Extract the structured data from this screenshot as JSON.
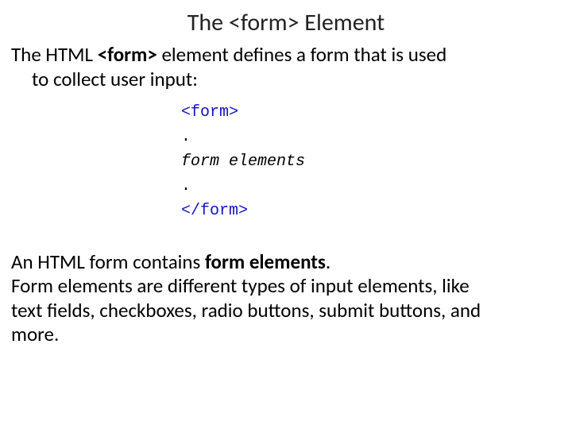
{
  "title": "The <form> Element",
  "intro": {
    "part1": "The HTML ",
    "bold": "<form>",
    "part2": " element defines a form that is used",
    "line2": "to collect user input:"
  },
  "code": {
    "open_tag": "<form>",
    "dot1": ".",
    "middle": "form elements",
    "dot2": ".",
    "close_tag": "</form>"
  },
  "para2": {
    "l1a": "An HTML form contains ",
    "l1b": "form elements",
    "l1c": ".",
    "l2": "Form elements are different types of input elements, like",
    "l3": "text fields, checkboxes, radio buttons, submit buttons, and",
    "l4": "more."
  }
}
